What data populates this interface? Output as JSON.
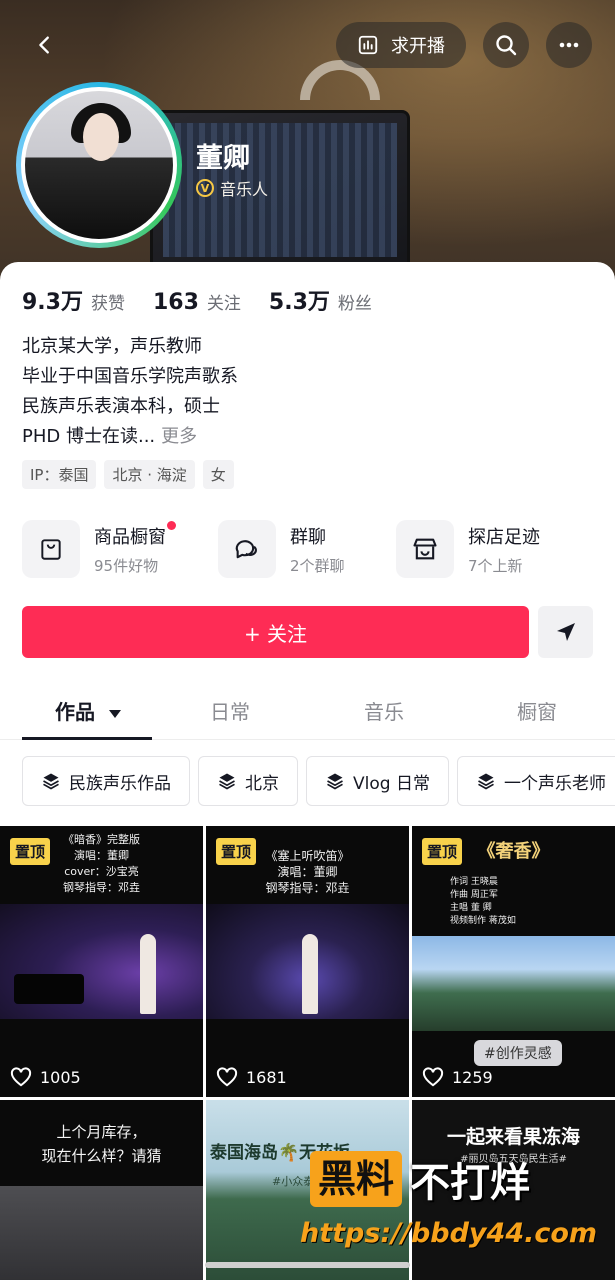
{
  "header": {
    "request_broadcast_label": "求开播",
    "name": "董卿",
    "verified_role": "音乐人",
    "verified_badge_text": "V"
  },
  "stats": [
    {
      "value": "9.3万",
      "label": "获赞"
    },
    {
      "value": "163",
      "label": "关注"
    },
    {
      "value": "5.3万",
      "label": "粉丝"
    }
  ],
  "bio": {
    "lines": [
      "北京某大学，声乐教师",
      "毕业于中国音乐学院声歌系",
      "民族声乐表演本科，硕士",
      "PHD 博士在读..."
    ],
    "more_label": "更多"
  },
  "tags": [
    "IP：泰国",
    "北京 · 海淀",
    "女"
  ],
  "services": [
    {
      "title": "商品橱窗",
      "sub": "95件好物",
      "icon": "shopping-bag-icon",
      "has_dot": true
    },
    {
      "title": "群聊",
      "sub": "2个群聊",
      "icon": "chat-bubbles-icon",
      "has_dot": false
    },
    {
      "title": "探店足迹",
      "sub": "7个上新",
      "icon": "store-icon",
      "has_dot": false
    }
  ],
  "follow_label": "+ 关注",
  "tabs": [
    "作品",
    "日常",
    "音乐",
    "橱窗"
  ],
  "chips": [
    "民族声乐作品",
    "北京",
    "Vlog 日常",
    "一个声乐老师"
  ],
  "videos": [
    {
      "pinned": true,
      "pin_label": "置顶",
      "caption": [
        "《暗香》完整版",
        "演唱：董卿",
        "cover：沙宝亮",
        "钢琴指导：邓垚"
      ],
      "likes": "1005"
    },
    {
      "pinned": true,
      "pin_label": "置顶",
      "caption": [
        "《塞上听吹笛》",
        "演唱：董卿",
        "钢琴指导：邓垚"
      ],
      "likes": "1681"
    },
    {
      "pinned": true,
      "pin_label": "置顶",
      "title": "《奢香》",
      "caption": [
        "作词 王晓晨",
        "作曲 周正军",
        "主唱 董 卿",
        "视频制作 蒋茂如"
      ],
      "pill": "#创作灵感",
      "likes": "1259"
    },
    {
      "title_lines": [
        "上个月库存，",
        "现在什么样？请猜"
      ]
    },
    {
      "title": "泰国海岛🌴无花坂",
      "sub": "#小众泰"
    },
    {
      "title": "一起来看果冻海",
      "sub": "#丽贝岛五天岛民生活#"
    }
  ],
  "watermark": {
    "box": "黑料",
    "text": "不打烊",
    "url": "https://bbdy44.com"
  },
  "colors": {
    "accent": "#fe2c55",
    "pin": "#f8d24b",
    "watermark": "#f7a21b"
  }
}
